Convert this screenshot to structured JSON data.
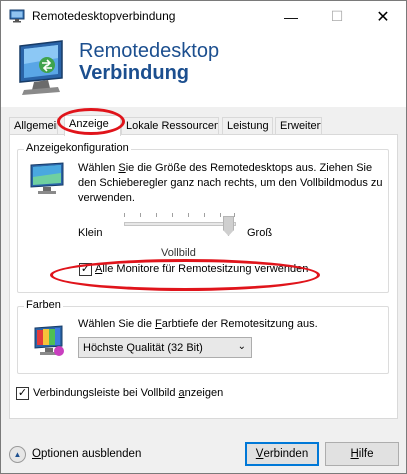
{
  "window": {
    "title": "Remotedesktopverbindung",
    "minimize_glyph": "—",
    "maximize_glyph": "☐",
    "close_glyph": "✕"
  },
  "banner": {
    "line1": "Remotedesktop",
    "line2": "Verbindung",
    "logo_icon": "remote-desktop-monitor-icon"
  },
  "tabs": [
    {
      "label": "Allgemein",
      "active": false
    },
    {
      "label": "Anzeige",
      "active": true
    },
    {
      "label": "Lokale Ressourcen",
      "active": false
    },
    {
      "label": "Leistung",
      "active": false
    },
    {
      "label": "Erweitert",
      "active": false
    }
  ],
  "display_config": {
    "legend": "Anzeigekonfiguration",
    "description_pre": "Wählen ",
    "description_ul": "S",
    "description_post": "ie die Größe des Remotedesktops aus. Ziehen Sie den Schieberegler ganz nach rechts, um den Vollbildmodus zu verwenden.",
    "slider_min_label": "Klein",
    "slider_max_label": "Groß",
    "slider_value_label": "Vollbild",
    "slider_position": 1.0,
    "all_monitors_checkbox": {
      "label_ul": "A",
      "label_rest": "lle Monitore für Remotesitzung verwenden",
      "checked": true
    }
  },
  "colors_group": {
    "legend": "Farben",
    "description_pre": "Wählen Sie die ",
    "description_ul": "F",
    "description_post": "arbtiefe der Remotesitzung aus.",
    "depth_selected": "Höchste Qualität (32 Bit)"
  },
  "connection_bar_checkbox": {
    "label_pre": "Verbindungsleiste bei Vollbild ",
    "label_ul": "a",
    "label_post": "nzeigen",
    "checked": true
  },
  "footer": {
    "options_ul": "O",
    "options_rest": "ptionen ausblenden",
    "connect_ul": "V",
    "connect_rest": "erbinden",
    "help_ul": "H",
    "help_rest": "ilfe"
  },
  "colors": {
    "accent": "#0078d7",
    "brand_text": "#1c4f8f",
    "annotation_red": "#e0141b"
  }
}
